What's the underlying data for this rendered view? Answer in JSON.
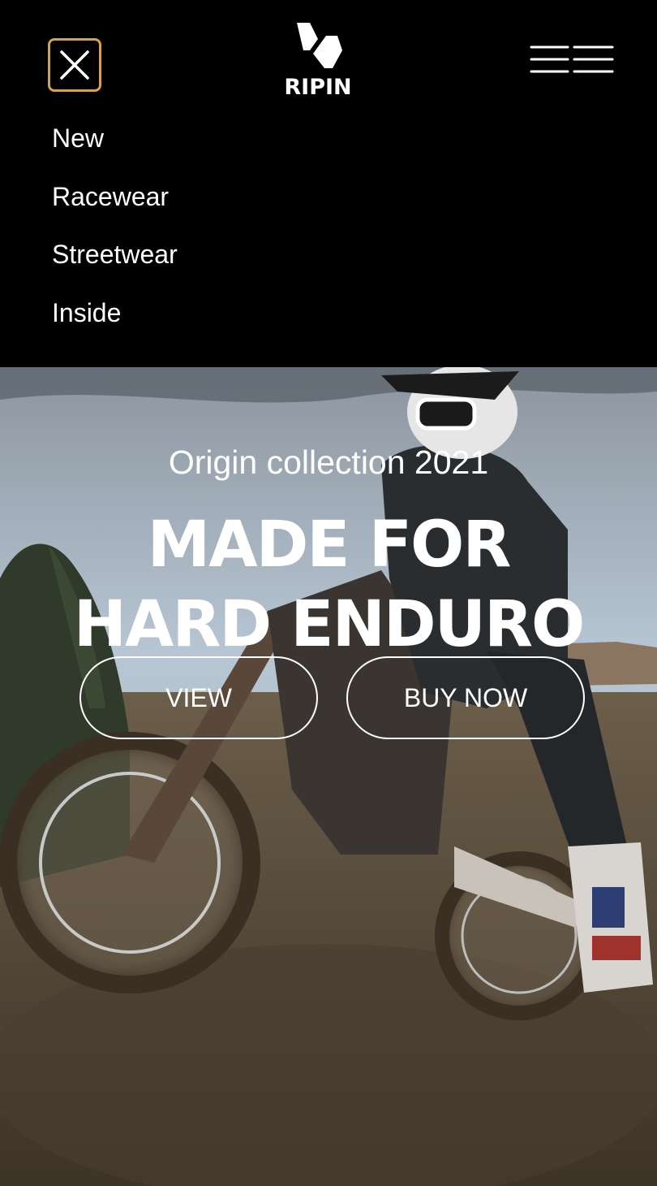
{
  "header": {
    "brand": "RIPIN",
    "close_icon": "close-icon",
    "menu_icon": "hamburger-menu-icon",
    "accent_color": "#d7a14f"
  },
  "nav": {
    "items": [
      {
        "label": "New"
      },
      {
        "label": "Racewear"
      },
      {
        "label": "Streetwear"
      },
      {
        "label": "Inside"
      }
    ]
  },
  "hero": {
    "subtitle": "Origin collection 2021",
    "title_line1": "MADE FOR",
    "title_line2": "HARD ENDURO",
    "buttons": {
      "view": "VIEW",
      "buy": "BUY NOW"
    }
  }
}
